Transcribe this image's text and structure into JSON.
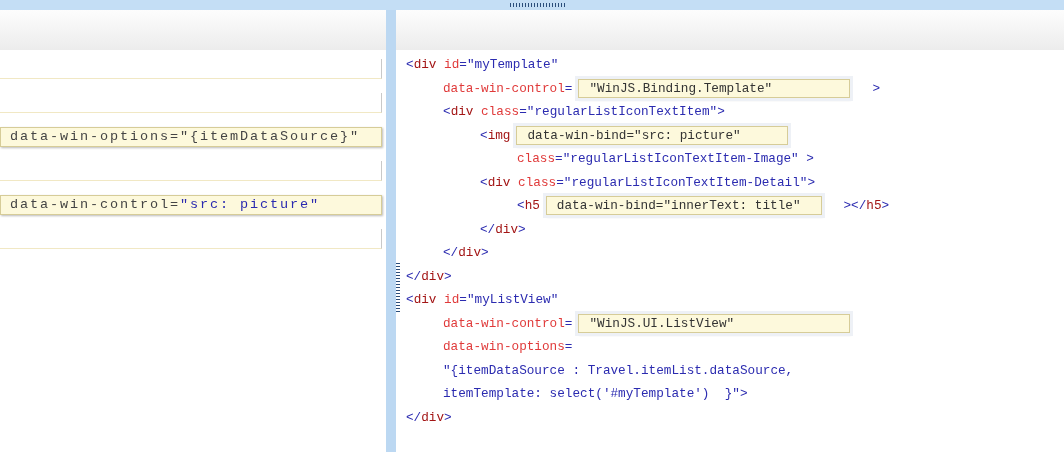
{
  "answer_slots": [
    {
      "kind": "empty"
    },
    {
      "kind": "empty"
    },
    {
      "kind": "filled",
      "tokens": [
        {
          "kind": "plain",
          "text": "data-win-options=\"{itemDataSource}\""
        }
      ]
    },
    {
      "kind": "empty"
    },
    {
      "kind": "filled",
      "tokens": [
        {
          "kind": "plain",
          "text": "data-win-control="
        },
        {
          "kind": "value",
          "text": "\"src: picture\""
        }
      ]
    },
    {
      "kind": "empty"
    }
  ],
  "code_lines": [
    {
      "segments": [
        {
          "kind": "code",
          "tokens": [
            {
              "kind": "punct",
              "text": "<"
            },
            {
              "kind": "tag",
              "text": "div "
            },
            {
              "kind": "attr",
              "text": "id"
            },
            {
              "kind": "punct",
              "text": "="
            },
            {
              "kind": "value",
              "text": "\"myTemplate\""
            }
          ]
        }
      ],
      "children": [
        {
          "segments": [
            {
              "kind": "code",
              "tokens": [
                {
                  "kind": "attr",
                  "text": "data-win-control"
                },
                {
                  "kind": "punct",
                  "text": "="
                }
              ]
            },
            {
              "kind": "slot",
              "text": "\"WinJS.Binding.Template\""
            },
            {
              "kind": "code",
              "tokens": [
                {
                  "kind": "punct",
                  "text": ">"
                }
              ]
            }
          ]
        },
        {
          "segments": [
            {
              "kind": "code",
              "tokens": [
                {
                  "kind": "punct",
                  "text": "<"
                },
                {
                  "kind": "tag",
                  "text": "div "
                },
                {
                  "kind": "attr",
                  "text": "class"
                },
                {
                  "kind": "punct",
                  "text": "="
                },
                {
                  "kind": "value",
                  "text": "\"regularListIconTextItem\""
                },
                {
                  "kind": "punct",
                  "text": ">"
                }
              ]
            }
          ],
          "children": [
            {
              "segments": [
                {
                  "kind": "code",
                  "tokens": [
                    {
                      "kind": "punct",
                      "text": "<"
                    },
                    {
                      "kind": "tag",
                      "text": "img"
                    }
                  ]
                },
                {
                  "kind": "slot",
                  "text": "data-win-bind=\"src: picture\""
                }
              ],
              "children": [
                {
                  "segments": [
                    {
                      "kind": "code",
                      "tokens": [
                        {
                          "kind": "attr",
                          "text": "class"
                        },
                        {
                          "kind": "punct",
                          "text": "="
                        },
                        {
                          "kind": "value",
                          "text": "\"regularListIconTextItem-Image\""
                        },
                        {
                          "kind": "punct",
                          "text": " >"
                        }
                      ]
                    }
                  ]
                }
              ]
            },
            {
              "segments": [
                {
                  "kind": "code",
                  "tokens": [
                    {
                      "kind": "punct",
                      "text": "<"
                    },
                    {
                      "kind": "tag",
                      "text": "div "
                    },
                    {
                      "kind": "attr",
                      "text": "class"
                    },
                    {
                      "kind": "punct",
                      "text": "="
                    },
                    {
                      "kind": "value",
                      "text": "\"regularListIconTextItem-Detail\""
                    },
                    {
                      "kind": "punct",
                      "text": ">"
                    }
                  ]
                }
              ],
              "children": [
                {
                  "segments": [
                    {
                      "kind": "code",
                      "tokens": [
                        {
                          "kind": "punct",
                          "text": "<"
                        },
                        {
                          "kind": "tag",
                          "text": "h5"
                        }
                      ]
                    },
                    {
                      "kind": "slot",
                      "text": "data-win-bind=\"innerText: title\""
                    },
                    {
                      "kind": "code",
                      "tokens": [
                        {
                          "kind": "punct",
                          "text": "></"
                        },
                        {
                          "kind": "tag",
                          "text": "h5"
                        },
                        {
                          "kind": "punct",
                          "text": ">"
                        }
                      ]
                    }
                  ]
                }
              ]
            },
            {
              "segments": [
                {
                  "kind": "code",
                  "tokens": [
                    {
                      "kind": "punct",
                      "text": "</"
                    },
                    {
                      "kind": "tag",
                      "text": "div"
                    },
                    {
                      "kind": "punct",
                      "text": ">"
                    }
                  ]
                }
              ]
            }
          ]
        },
        {
          "segments": [
            {
              "kind": "code",
              "tokens": [
                {
                  "kind": "punct",
                  "text": "</"
                },
                {
                  "kind": "tag",
                  "text": "div"
                },
                {
                  "kind": "punct",
                  "text": ">"
                }
              ]
            }
          ]
        }
      ]
    },
    {
      "segments": [
        {
          "kind": "code",
          "tokens": [
            {
              "kind": "punct",
              "text": "</"
            },
            {
              "kind": "tag",
              "text": "div"
            },
            {
              "kind": "punct",
              "text": ">"
            }
          ]
        }
      ]
    },
    {
      "segments": [
        {
          "kind": "code",
          "tokens": [
            {
              "kind": "punct",
              "text": "<"
            },
            {
              "kind": "tag",
              "text": "div "
            },
            {
              "kind": "attr",
              "text": "id"
            },
            {
              "kind": "punct",
              "text": "="
            },
            {
              "kind": "value",
              "text": "\"myListView\""
            }
          ]
        }
      ],
      "children": [
        {
          "segments": [
            {
              "kind": "code",
              "tokens": [
                {
                  "kind": "attr",
                  "text": "data-win-control"
                },
                {
                  "kind": "punct",
                  "text": "="
                }
              ]
            },
            {
              "kind": "slot",
              "text": "\"WinJS.UI.ListView\""
            }
          ]
        },
        {
          "segments": [
            {
              "kind": "code",
              "tokens": [
                {
                  "kind": "attr",
                  "text": "data-win-options"
                },
                {
                  "kind": "punct",
                  "text": "="
                }
              ]
            }
          ]
        },
        {
          "segments": [
            {
              "kind": "code",
              "tokens": [
                {
                  "kind": "value",
                  "text": "\"{itemDataSource : Travel.itemList.dataSource,"
                }
              ]
            }
          ]
        },
        {
          "segments": [
            {
              "kind": "code",
              "tokens": [
                {
                  "kind": "value",
                  "text": "itemTemplate: select('#myTemplate')  }\""
                },
                {
                  "kind": "punct",
                  "text": ">"
                }
              ]
            }
          ]
        }
      ]
    },
    {
      "segments": [
        {
          "kind": "code",
          "tokens": [
            {
              "kind": "punct",
              "text": "</"
            },
            {
              "kind": "tag",
              "text": "div"
            },
            {
              "kind": "punct",
              "text": ">"
            }
          ]
        }
      ]
    }
  ]
}
